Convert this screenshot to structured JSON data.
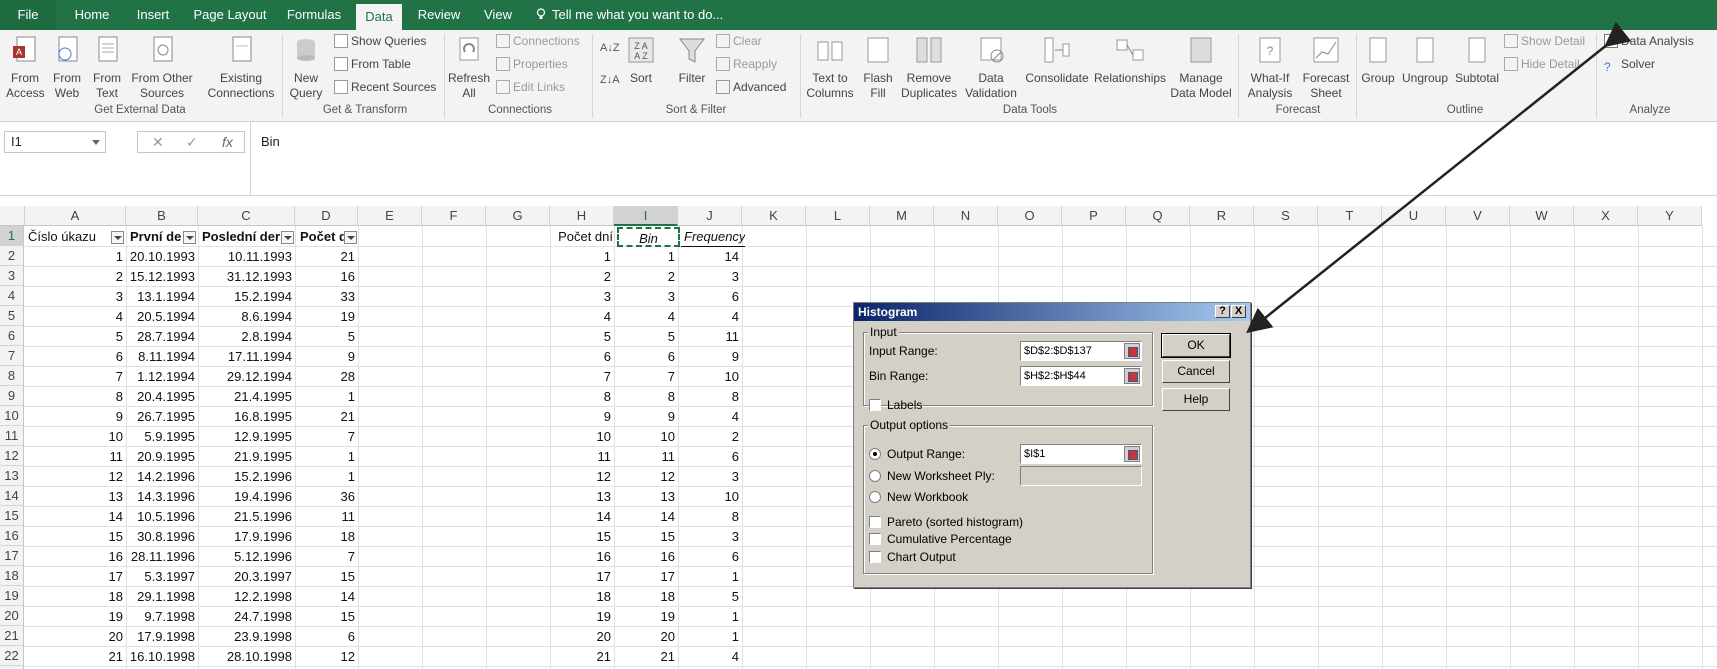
{
  "tabs": [
    "File",
    "Home",
    "Insert",
    "Page Layout",
    "Formulas",
    "Data",
    "Review",
    "View"
  ],
  "tell_me": "Tell me what you want to do...",
  "ribbon": {
    "get_external": {
      "label": "Get External Data",
      "items": [
        "From Access",
        "From Web",
        "From Text",
        "From Other Sources",
        "Existing Connections"
      ]
    },
    "get_transform": {
      "label": "Get & Transform",
      "new_query": "New Query",
      "items": [
        "Show Queries",
        "From Table",
        "Recent Sources"
      ]
    },
    "connections": {
      "label": "Connections",
      "refresh": "Refresh All",
      "items": [
        "Connections",
        "Properties",
        "Edit Links"
      ]
    },
    "sort_filter": {
      "label": "Sort & Filter",
      "sort": "Sort",
      "filter": "Filter",
      "items": [
        "Clear",
        "Reapply",
        "Advanced"
      ]
    },
    "data_tools": {
      "label": "Data Tools",
      "items": [
        "Text to Columns",
        "Flash Fill",
        "Remove Duplicates",
        "Data Validation",
        "Consolidate",
        "Relationships",
        "Manage Data Model"
      ]
    },
    "forecast": {
      "label": "Forecast",
      "items": [
        "What-If Analysis",
        "Forecast Sheet"
      ]
    },
    "outline": {
      "label": "Outline",
      "items": [
        "Group",
        "Ungroup",
        "Subtotal",
        "Show Detail",
        "Hide Detail"
      ]
    },
    "analyze": {
      "label": "Analyze",
      "items": [
        "Data Analysis",
        "Solver"
      ]
    }
  },
  "formula_bar": {
    "name_box": "I1",
    "content": "Bin"
  },
  "columns": [
    "A",
    "B",
    "C",
    "D",
    "E",
    "F",
    "G",
    "H",
    "I",
    "J",
    "K",
    "L",
    "M",
    "N",
    "O",
    "P",
    "Q",
    "R",
    "S",
    "T",
    "U",
    "V",
    "W",
    "X",
    "Y"
  ],
  "header_row": {
    "A": "Číslo úkazu",
    "B": "První de",
    "C": "Poslední der",
    "D": "Počet d",
    "H": "Počet dní",
    "I": "Bin",
    "J": "Frequency"
  },
  "rows": [
    [
      "1",
      "20.10.1993",
      "10.11.1993",
      "21",
      "1",
      "1",
      "14"
    ],
    [
      "2",
      "15.12.1993",
      "31.12.1993",
      "16",
      "2",
      "2",
      "3"
    ],
    [
      "3",
      "13.1.1994",
      "15.2.1994",
      "33",
      "3",
      "3",
      "6"
    ],
    [
      "4",
      "20.5.1994",
      "8.6.1994",
      "19",
      "4",
      "4",
      "4"
    ],
    [
      "5",
      "28.7.1994",
      "2.8.1994",
      "5",
      "5",
      "5",
      "11"
    ],
    [
      "6",
      "8.11.1994",
      "17.11.1994",
      "9",
      "6",
      "6",
      "9"
    ],
    [
      "7",
      "1.12.1994",
      "29.12.1994",
      "28",
      "7",
      "7",
      "10"
    ],
    [
      "8",
      "20.4.1995",
      "21.4.1995",
      "1",
      "8",
      "8",
      "8"
    ],
    [
      "9",
      "26.7.1995",
      "16.8.1995",
      "21",
      "9",
      "9",
      "4"
    ],
    [
      "10",
      "5.9.1995",
      "12.9.1995",
      "7",
      "10",
      "10",
      "2"
    ],
    [
      "11",
      "20.9.1995",
      "21.9.1995",
      "1",
      "11",
      "11",
      "6"
    ],
    [
      "12",
      "14.2.1996",
      "15.2.1996",
      "1",
      "12",
      "12",
      "3"
    ],
    [
      "13",
      "14.3.1996",
      "19.4.1996",
      "36",
      "13",
      "13",
      "10"
    ],
    [
      "14",
      "10.5.1996",
      "21.5.1996",
      "11",
      "14",
      "14",
      "8"
    ],
    [
      "15",
      "30.8.1996",
      "17.9.1996",
      "18",
      "15",
      "15",
      "3"
    ],
    [
      "16",
      "28.11.1996",
      "5.12.1996",
      "7",
      "16",
      "16",
      "6"
    ],
    [
      "17",
      "5.3.1997",
      "20.3.1997",
      "15",
      "17",
      "17",
      "1"
    ],
    [
      "18",
      "29.1.1998",
      "12.2.1998",
      "14",
      "18",
      "18",
      "5"
    ],
    [
      "19",
      "9.7.1998",
      "24.7.1998",
      "15",
      "19",
      "19",
      "1"
    ],
    [
      "20",
      "17.9.1998",
      "23.9.1998",
      "6",
      "20",
      "20",
      "1"
    ],
    [
      "21",
      "16.10.1998",
      "28.10.1998",
      "12",
      "21",
      "21",
      "4"
    ]
  ],
  "dialog": {
    "title": "Histogram",
    "help_q": "?",
    "close": "X",
    "input_legend": "Input",
    "input_range_label": "Input Range:",
    "input_range_value": "$D$2:$D$137",
    "bin_range_label": "Bin Range:",
    "bin_range_value": "$H$2:$H$44",
    "labels_label": "Labels",
    "output_legend": "Output options",
    "output_range_label": "Output Range:",
    "output_range_value": "$I$1",
    "new_ws_label": "New Worksheet Ply:",
    "new_wb_label": "New Workbook",
    "pareto_label": "Pareto (sorted histogram)",
    "cumulative_label": "Cumulative Percentage",
    "chart_label": "Chart Output",
    "ok": "OK",
    "cancel": "Cancel",
    "help": "Help"
  },
  "colors": {
    "excel_green": "#217346",
    "ribbon_bg": "#f3f3f3",
    "dialog_bg": "#d4d0c8",
    "title_gradient_start": "#0a246a",
    "title_gradient_end": "#a6caf0"
  }
}
